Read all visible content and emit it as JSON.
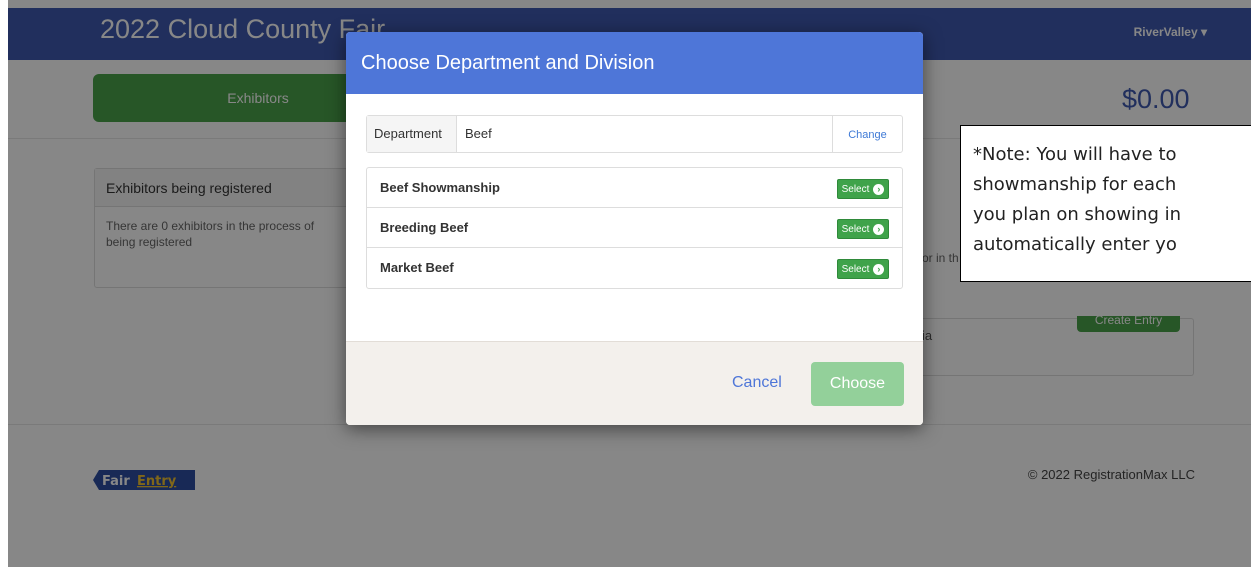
{
  "navbar": {
    "title": "2022 Cloud County Fair",
    "user_menu": "RiverValley ▾"
  },
  "tabs": {
    "exhibitors": "Exhibitors"
  },
  "cart": {
    "total": "$0.00"
  },
  "panel": {
    "title": "Exhibitors being registered",
    "body_line1": "There are 0 exhibitors in the process of",
    "body_line2": "being registered",
    "fragment_right": "or in th",
    "fragment_ia": "ia",
    "create_entry": "Create Entry"
  },
  "footer": {
    "logo": {
      "fair": "Fair",
      "entry": "Entry"
    },
    "copyright": "© 2022 RegistrationMax LLC"
  },
  "modal": {
    "title": "Choose Department and Division",
    "department_label": "Department",
    "department_value": "Beef",
    "change_link": "Change",
    "divisions": [
      {
        "name": "Beef Showmanship",
        "select_label": "Select"
      },
      {
        "name": "Breeding Beef",
        "select_label": "Select"
      },
      {
        "name": "Market Beef",
        "select_label": "Select"
      }
    ],
    "cancel_label": "Cancel",
    "choose_label": "Choose"
  },
  "note": {
    "text": "*Note: You will have to\nshowmanship for each\nyou plan on showing in\nautomatically enter yo"
  },
  "colors": {
    "navbar": "#3f5ab0",
    "modal_header": "#4e76d8",
    "green": "#4aa24a",
    "choose_disabled": "#93d09a"
  }
}
